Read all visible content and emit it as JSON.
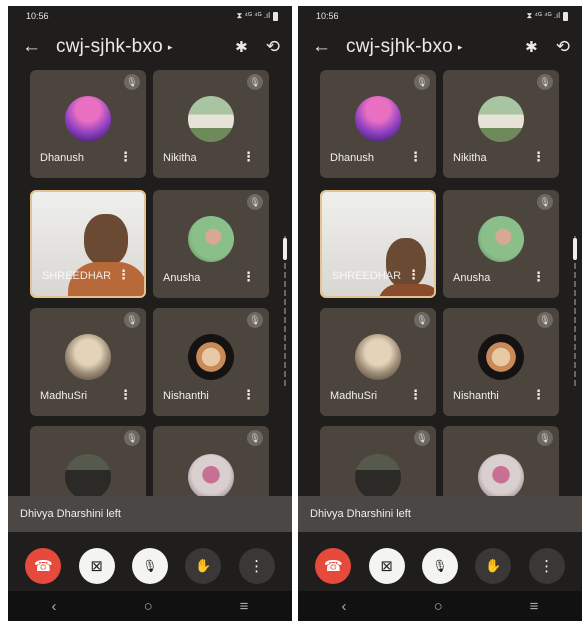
{
  "screens": [
    {
      "status": {
        "time": "10:56",
        "signal": "⧗ ⁴ᴳ ⁴ᴳ .ıl"
      },
      "header": {
        "title": "cwj-sjhk-bxo"
      },
      "tiles": [
        {
          "name": "Dhanush",
          "kind": "avatar",
          "avatar": "sunset"
        },
        {
          "name": "Nikitha",
          "kind": "avatar",
          "avatar": "field"
        },
        {
          "name": "SHREEDHAR",
          "kind": "video"
        },
        {
          "name": "Anusha",
          "kind": "avatar",
          "avatar": "green"
        },
        {
          "name": "MadhuSri",
          "kind": "avatar",
          "avatar": "beige"
        },
        {
          "name": "Nishanthi",
          "kind": "avatar",
          "avatar": "portrait"
        },
        {
          "name": "",
          "kind": "avatar",
          "avatar": "dark"
        },
        {
          "name": "",
          "kind": "avatar",
          "avatar": "pink"
        }
      ],
      "toast": "Dhivya Dharshini left"
    },
    {
      "status": {
        "time": "10:56",
        "signal": "⧗ ⁴ᴳ ⁴ᴳ .ıl"
      },
      "header": {
        "title": "cwj-sjhk-bxo"
      },
      "tiles": [
        {
          "name": "Dhanush",
          "kind": "avatar",
          "avatar": "sunset"
        },
        {
          "name": "Nikitha",
          "kind": "avatar",
          "avatar": "field"
        },
        {
          "name": "SHREEDHAR",
          "kind": "video"
        },
        {
          "name": "Anusha",
          "kind": "avatar",
          "avatar": "green"
        },
        {
          "name": "MadhuSri",
          "kind": "avatar",
          "avatar": "beige"
        },
        {
          "name": "Nishanthi",
          "kind": "avatar",
          "avatar": "portrait"
        },
        {
          "name": "",
          "kind": "avatar",
          "avatar": "dark"
        },
        {
          "name": "",
          "kind": "avatar",
          "avatar": "pink"
        }
      ],
      "toast": "Dhivya Dharshini left"
    }
  ],
  "icons": {
    "back": "←",
    "caret": "▸",
    "bluetooth": "✱",
    "flip_camera": "⟲",
    "mute": "🎙",
    "more": "⋮",
    "end_call": "☎",
    "camera_off": "⊠",
    "mic_off": "🎙",
    "raise_hand": "✋",
    "nav_back": "‹",
    "nav_home": "○",
    "nav_recent": "≡"
  },
  "colors": {
    "tile_bg": "#4c453e",
    "end_call": "#e64a3c",
    "screen_bg": "#1f1e1c"
  }
}
